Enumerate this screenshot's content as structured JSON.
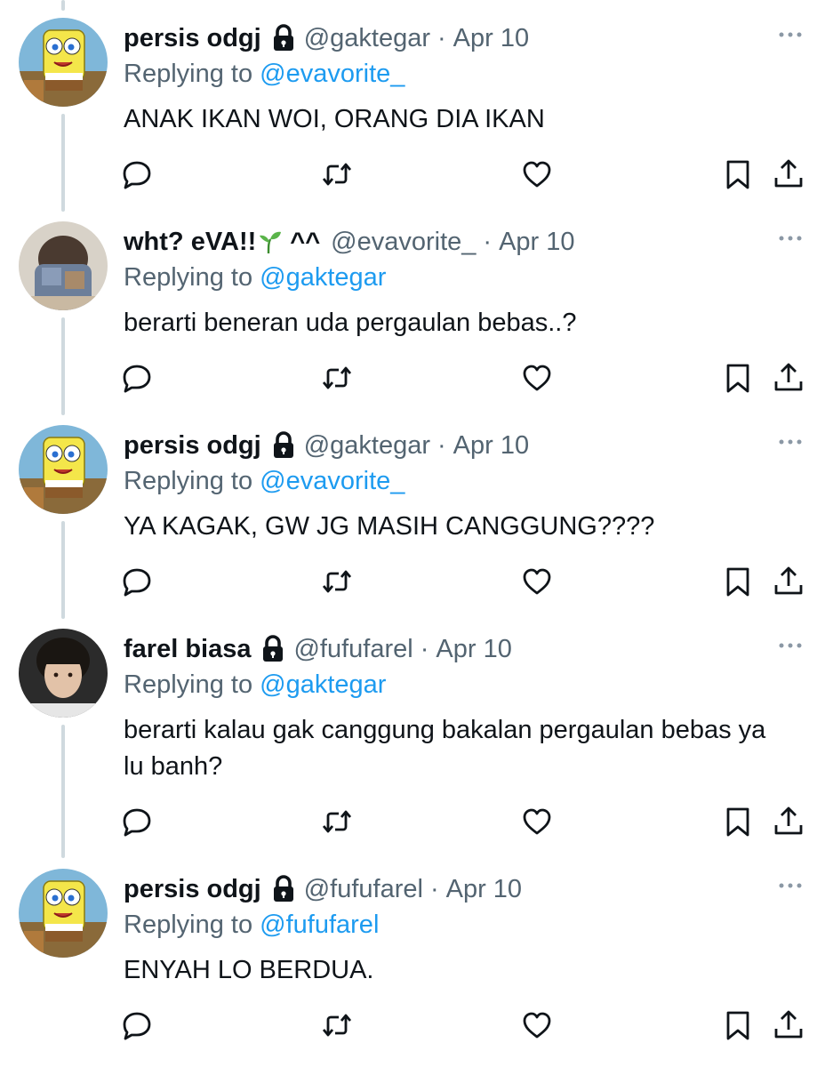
{
  "tweets": [
    {
      "display_name": "persis odgj",
      "name_extra": "",
      "protected": true,
      "handle": "@gaktegar",
      "separator": "·",
      "date": "Apr 10",
      "replying_prefix": "Replying to",
      "replying_mention": "@evavorite_",
      "text": "ANAK IKAN WOI, ORANG DIA IKAN",
      "avatar": "spongebob-avatar"
    },
    {
      "display_name": "wht? eVA!!",
      "name_extra": "^^",
      "protected": false,
      "handle": "@evavorite_",
      "separator": "·",
      "date": "Apr 10",
      "replying_prefix": "Replying to",
      "replying_mention": "@gaktegar",
      "text": "berarti beneran uda pergaulan bebas..?",
      "avatar": "person-covered-face-avatar"
    },
    {
      "display_name": "persis odgj",
      "name_extra": "",
      "protected": true,
      "handle": "@gaktegar",
      "separator": "·",
      "date": "Apr 10",
      "replying_prefix": "Replying to",
      "replying_mention": "@evavorite_",
      "text": "YA KAGAK, GW JG MASIH CANGGUNG????",
      "avatar": "spongebob-avatar"
    },
    {
      "display_name": "farel biasa",
      "name_extra": "",
      "protected": true,
      "handle": "@fufufarel",
      "separator": "·",
      "date": "Apr 10",
      "replying_prefix": "Replying to",
      "replying_mention": "@gaktegar",
      "text": "berarti kalau gak canggung bakalan pergaulan bebas ya lu banh?",
      "avatar": "person-portrait-avatar"
    },
    {
      "display_name": "persis odgj",
      "name_extra": "",
      "protected": true,
      "handle": "@fufufarel",
      "separator": "·",
      "date": "Apr 10",
      "replying_prefix": "Replying to",
      "replying_mention": "@fufufarel",
      "text": "ENYAH LO BERDUA.",
      "avatar": "spongebob-avatar"
    }
  ],
  "icons": {
    "reply": "reply-icon",
    "retweet": "retweet-icon",
    "like": "like-icon",
    "bookmark": "bookmark-icon",
    "share": "share-icon",
    "more": "more-icon",
    "lock": "lock-icon",
    "sprout": "sprout-emoji"
  },
  "colors": {
    "text_primary": "#0f1419",
    "text_secondary": "#536471",
    "link": "#1d9bf0",
    "thread_line": "#cfd9de"
  }
}
